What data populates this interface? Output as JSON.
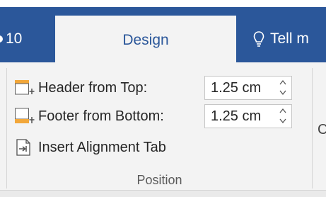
{
  "tabs": {
    "previous_label": "10",
    "active_label": "Design",
    "tell_me_label": "Tell m"
  },
  "fields": {
    "header_from_top": {
      "label": "Header from Top:",
      "value": "1.25 cm"
    },
    "footer_from_bottom": {
      "label": "Footer from Bottom:",
      "value": "1.25 cm"
    }
  },
  "buttons": {
    "insert_alignment_tab": "Insert Alignment Tab"
  },
  "group": {
    "label": "Position"
  },
  "cutoff_text": "C",
  "icons": {
    "header_from_top": "header-top-icon",
    "footer_from_bottom": "footer-bottom-icon",
    "insert_alignment_tab": "alignment-tab-icon",
    "tell_me": "lightbulb-icon",
    "spinner_up": "chevron-up-icon",
    "spinner_down": "chevron-down-icon"
  },
  "colors": {
    "accent": "#2b579a",
    "icon_orange": "#f2a73a",
    "icon_gray": "#505050"
  }
}
